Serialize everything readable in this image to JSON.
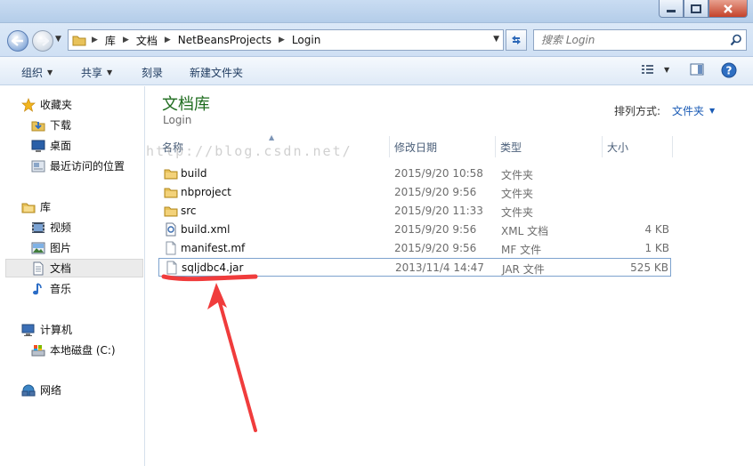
{
  "window": {
    "controls": [
      "minimize",
      "maximize",
      "close"
    ]
  },
  "address": {
    "crumbs": [
      "库",
      "文档",
      "NetBeansProjects",
      "Login"
    ],
    "search_placeholder": "搜索 Login"
  },
  "commands": {
    "organize": "组织",
    "share": "共享",
    "burn": "刻录",
    "new_folder": "新建文件夹"
  },
  "nav": {
    "favorites": "收藏夹",
    "downloads": "下载",
    "desktop": "桌面",
    "recent": "最近访问的位置",
    "libraries": "库",
    "videos": "视频",
    "pictures": "图片",
    "documents": "文档",
    "music": "音乐",
    "computer": "计算机",
    "local_disk": "本地磁盘 (C:)",
    "network": "网络"
  },
  "library": {
    "title": "文档库",
    "subtitle": "Login",
    "arrange_label": "排列方式:",
    "arrange_value": "文件夹"
  },
  "columns": {
    "name": "名称",
    "date": "修改日期",
    "type": "类型",
    "size": "大小"
  },
  "files": [
    {
      "name": "build",
      "date": "2015/9/20 10:58",
      "type": "文件夹",
      "size": "",
      "icon": "folder-icon"
    },
    {
      "name": "nbproject",
      "date": "2015/9/20 9:56",
      "type": "文件夹",
      "size": "",
      "icon": "folder-icon"
    },
    {
      "name": "src",
      "date": "2015/9/20 11:33",
      "type": "文件夹",
      "size": "",
      "icon": "folder-icon"
    },
    {
      "name": "build.xml",
      "date": "2015/9/20 9:56",
      "type": "XML 文档",
      "size": "4 KB",
      "icon": "xml-file-icon"
    },
    {
      "name": "manifest.mf",
      "date": "2015/9/20 9:56",
      "type": "MF 文件",
      "size": "1 KB",
      "icon": "file-icon"
    },
    {
      "name": "sqljdbc4.jar",
      "date": "2013/11/4 14:47",
      "type": "JAR 文件",
      "size": "525 KB",
      "icon": "file-icon"
    }
  ],
  "watermark": "http://blog.csdn.net/",
  "colors": {
    "library_title": "#1e6c1e",
    "link_blue": "#1a5bb5",
    "annotation_red": "#f03c3c"
  }
}
